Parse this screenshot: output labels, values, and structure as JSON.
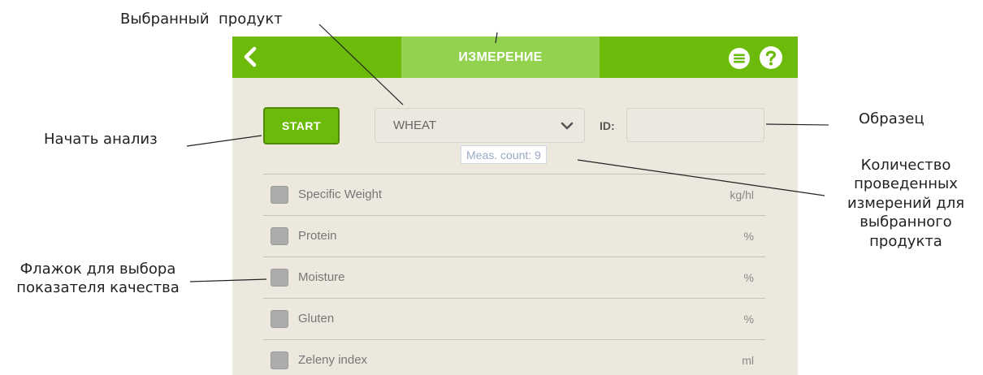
{
  "annotations": {
    "selected_product": "Выбранный  продукт",
    "start_analysis": "Начать анализ",
    "sample": "Образец",
    "meas_count_line1": "Количество",
    "meas_count_line2": "проведенных",
    "meas_count_line3": "измерений для",
    "meas_count_line4": "выбранного",
    "meas_count_line5": "продукта",
    "checkbox_line1": "Флажок для выбора",
    "checkbox_line2": "показателя качества"
  },
  "header": {
    "title": "ИЗМЕРЕНИЕ",
    "back_icon": "chevron-left-icon",
    "menu_icon": "menu-icon",
    "help_icon": "help-icon",
    "accent_color": "#6cba0a",
    "tab_color": "#93d24f"
  },
  "controls": {
    "start_label": "START",
    "product_value": "WHEAT",
    "id_label": "ID:",
    "id_value": "",
    "meas_count": "Meas. count: 9"
  },
  "parameters": [
    {
      "name": "Specific Weight",
      "unit": "kg/hl"
    },
    {
      "name": "Protein",
      "unit": "%"
    },
    {
      "name": "Moisture",
      "unit": "%"
    },
    {
      "name": "Gluten",
      "unit": "%"
    },
    {
      "name": "Zeleny index",
      "unit": "ml"
    }
  ]
}
